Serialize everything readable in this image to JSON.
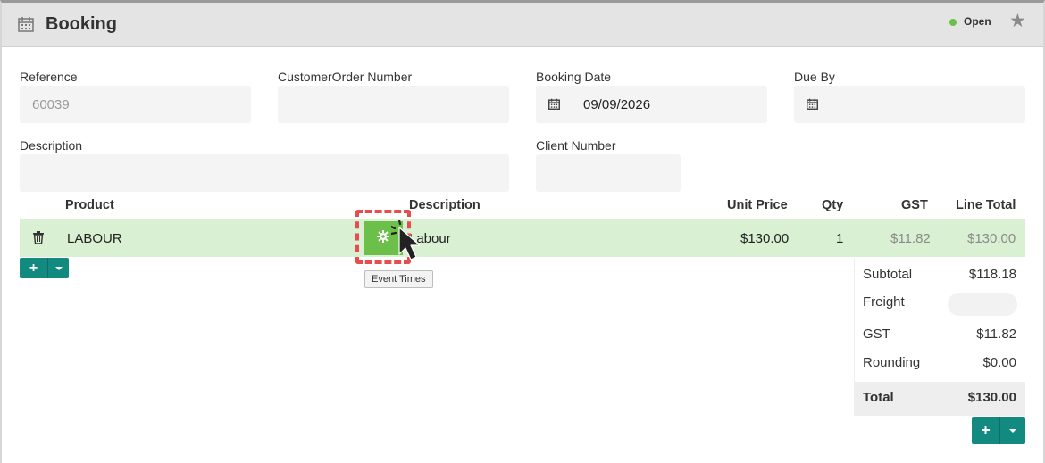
{
  "header": {
    "title": "Booking",
    "status": "Open"
  },
  "form": {
    "reference_label": "Reference",
    "reference_value": "60039",
    "customer_order_label": "CustomerOrder Number",
    "customer_order_value": "",
    "booking_date_label": "Booking Date",
    "booking_date_value": "09/09/2026",
    "due_by_label": "Due By",
    "due_by_value": "",
    "description_label": "Description",
    "description_value": "",
    "client_number_label": "Client Number",
    "client_number_value": ""
  },
  "lines": {
    "headers": {
      "product": "Product",
      "description": "Description",
      "unit_price": "Unit Price",
      "qty": "Qty",
      "gst": "GST",
      "line_total": "Line Total"
    },
    "rows": [
      {
        "product": "LABOUR",
        "description": "Labour",
        "unit_price": "$130.00",
        "qty": "1",
        "gst": "$11.82",
        "line_total": "$130.00"
      }
    ]
  },
  "tooltip": "Event Times",
  "totals": {
    "subtotal_label": "Subtotal",
    "subtotal_value": "$118.18",
    "freight_label": "Freight",
    "freight_value": "",
    "gst_label": "GST",
    "gst_value": "$11.82",
    "rounding_label": "Rounding",
    "rounding_value": "$0.00",
    "total_label": "Total",
    "total_value": "$130.00"
  },
  "buttons": {
    "add_symbol": "+"
  },
  "colors": {
    "accent": "#138a80",
    "row_highlight": "#d9f0d3",
    "gear_green": "#6cc04a",
    "status_open": "#6cc04a",
    "highlight_dash": "#e84c4c"
  },
  "icons": [
    "calendar-icon",
    "star-icon",
    "trash-icon",
    "gear-icon",
    "plus-icon",
    "caret-down-icon",
    "cursor-icon"
  ]
}
